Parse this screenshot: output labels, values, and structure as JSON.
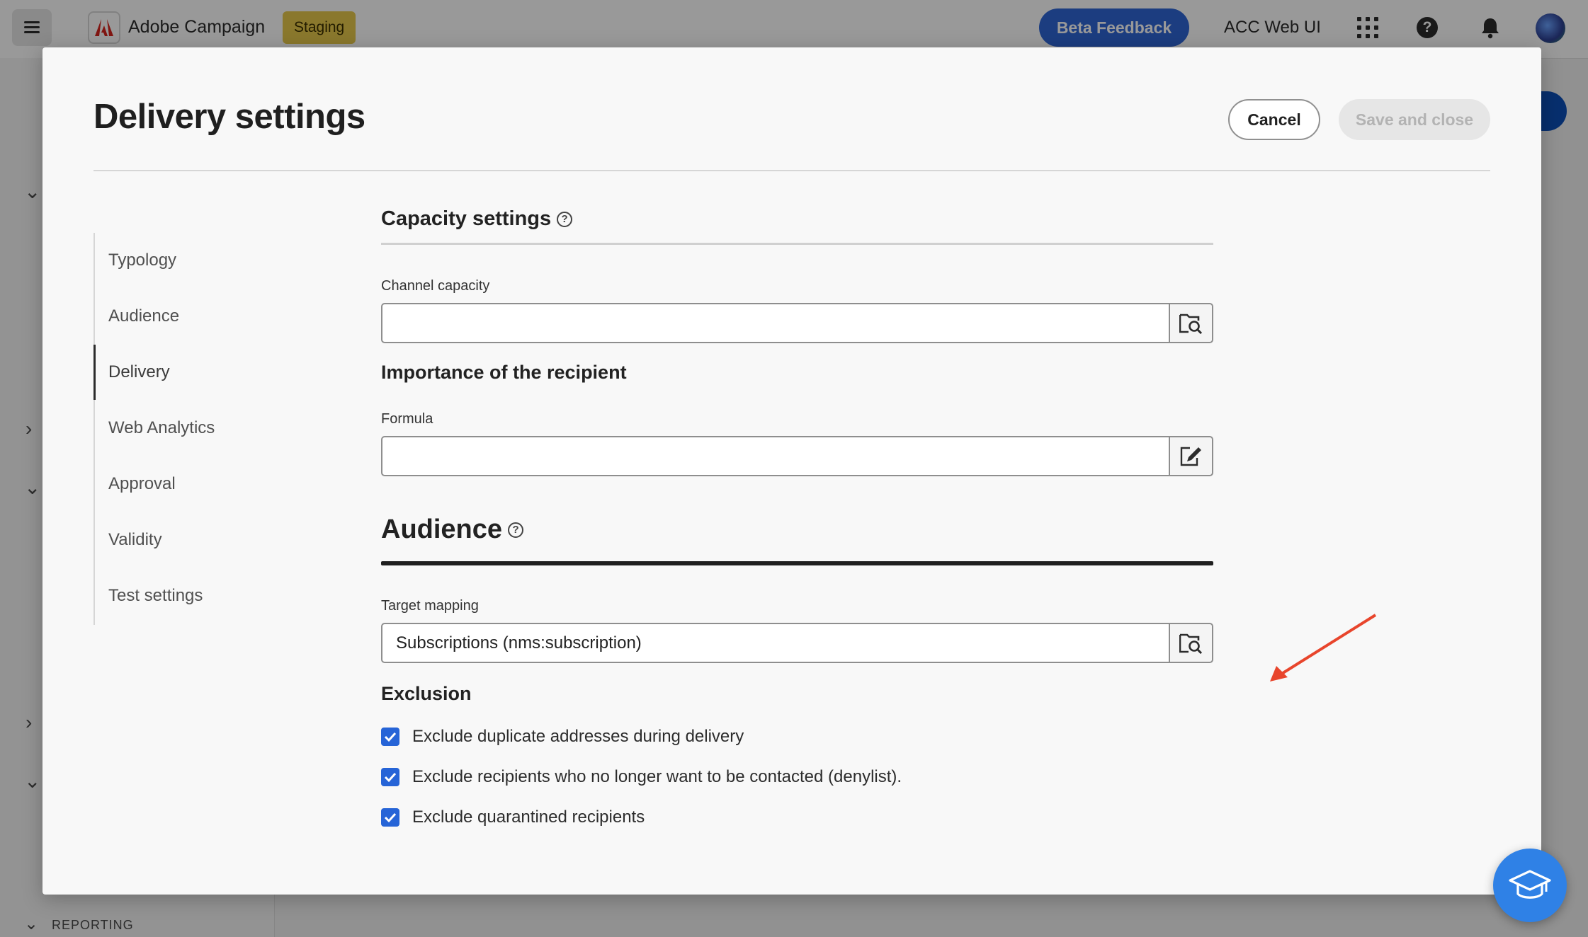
{
  "topbar": {
    "app_name": "Adobe Campaign",
    "environment_badge": "Staging",
    "beta_feedback_label": "Beta Feedback",
    "org_name": "ACC Web UI",
    "icons": [
      "menu-icon",
      "adobe-logo-icon",
      "apps-grid-icon",
      "help-icon",
      "bell-icon",
      "avatar"
    ]
  },
  "sidebar": {
    "reporting_label": "REPORTING"
  },
  "modal": {
    "title": "Delivery settings",
    "cancel_label": "Cancel",
    "save_label": "Save and close",
    "nav": {
      "items": [
        {
          "label": "Typology",
          "active": false
        },
        {
          "label": "Audience",
          "active": false
        },
        {
          "label": "Delivery",
          "active": true
        },
        {
          "label": "Web Analytics",
          "active": false
        },
        {
          "label": "Approval",
          "active": false
        },
        {
          "label": "Validity",
          "active": false
        },
        {
          "label": "Test settings",
          "active": false
        }
      ]
    },
    "capacity": {
      "heading": "Capacity settings",
      "channel_capacity_label": "Channel capacity",
      "channel_capacity_value": "",
      "importance_heading": "Importance of the recipient",
      "formula_label": "Formula",
      "formula_value": ""
    },
    "audience": {
      "heading": "Audience",
      "target_mapping_label": "Target mapping",
      "target_mapping_value": "Subscriptions (nms:subscription)",
      "exclusion_heading": "Exclusion",
      "exclusions": [
        {
          "label": "Exclude duplicate addresses during delivery",
          "checked": true
        },
        {
          "label": "Exclude recipients who no longer want to be contacted (denylist).",
          "checked": true
        },
        {
          "label": "Exclude quarantined recipients",
          "checked": true
        }
      ]
    }
  },
  "colors": {
    "accent": "#2f66d6",
    "checkbox": "#2664d7",
    "annotation_arrow": "#e8452c",
    "staging_badge": "#e6c94b"
  }
}
